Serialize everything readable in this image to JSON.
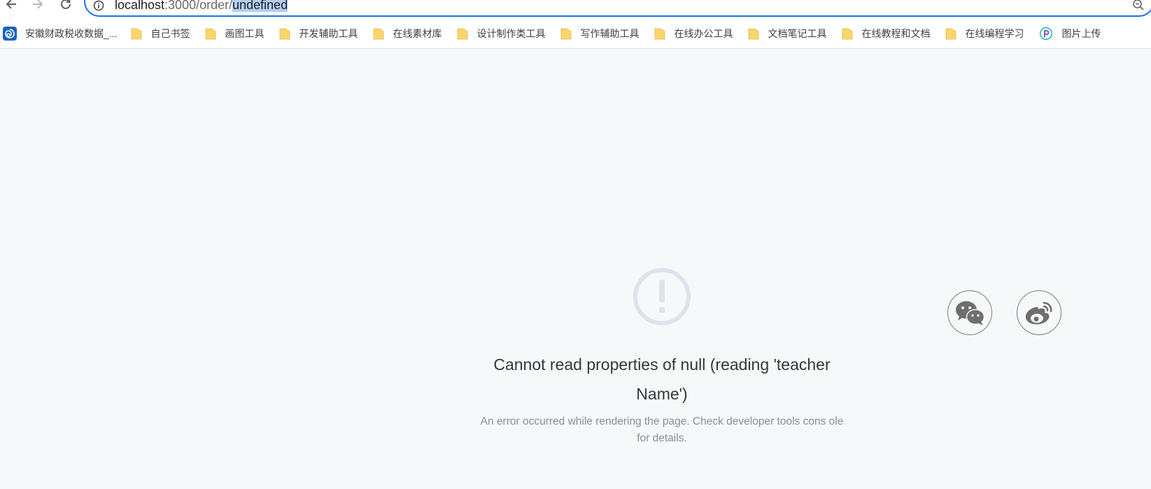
{
  "browser": {
    "url_host": "localhost",
    "url_port_path": ":3000/order/",
    "url_selected": "undefined"
  },
  "bookmarks": [
    {
      "icon": "swirl-site-icon",
      "label": "安徽财政税收数据_..."
    },
    {
      "icon": "folder-icon",
      "label": "自己书签"
    },
    {
      "icon": "folder-icon",
      "label": "画图工具"
    },
    {
      "icon": "folder-icon",
      "label": "开发辅助工具"
    },
    {
      "icon": "folder-icon",
      "label": "在线素材库"
    },
    {
      "icon": "folder-icon",
      "label": "设计制作类工具"
    },
    {
      "icon": "folder-icon",
      "label": "写作辅助工具"
    },
    {
      "icon": "folder-icon",
      "label": "在线办公工具"
    },
    {
      "icon": "folder-icon",
      "label": "文档笔记工具"
    },
    {
      "icon": "folder-icon",
      "label": "在线教程和文档"
    },
    {
      "icon": "folder-icon",
      "label": "在线编程学习"
    },
    {
      "icon": "p-site-icon",
      "label": "图片上传"
    }
  ],
  "error": {
    "icon": "exclamation-circle-icon",
    "title": "Cannot read properties of null (reading 'teacher Name')",
    "description": "An error occurred while rendering the page. Check developer tools cons ole for details."
  },
  "social": {
    "wechat_icon": "wechat-icon",
    "weibo_icon": "weibo-icon"
  },
  "colors": {
    "omnibox_border": "#1a73e8",
    "folder": "#f9d66c",
    "error_icon": "#dde2ec",
    "page_bg": "#f7f8fa"
  }
}
